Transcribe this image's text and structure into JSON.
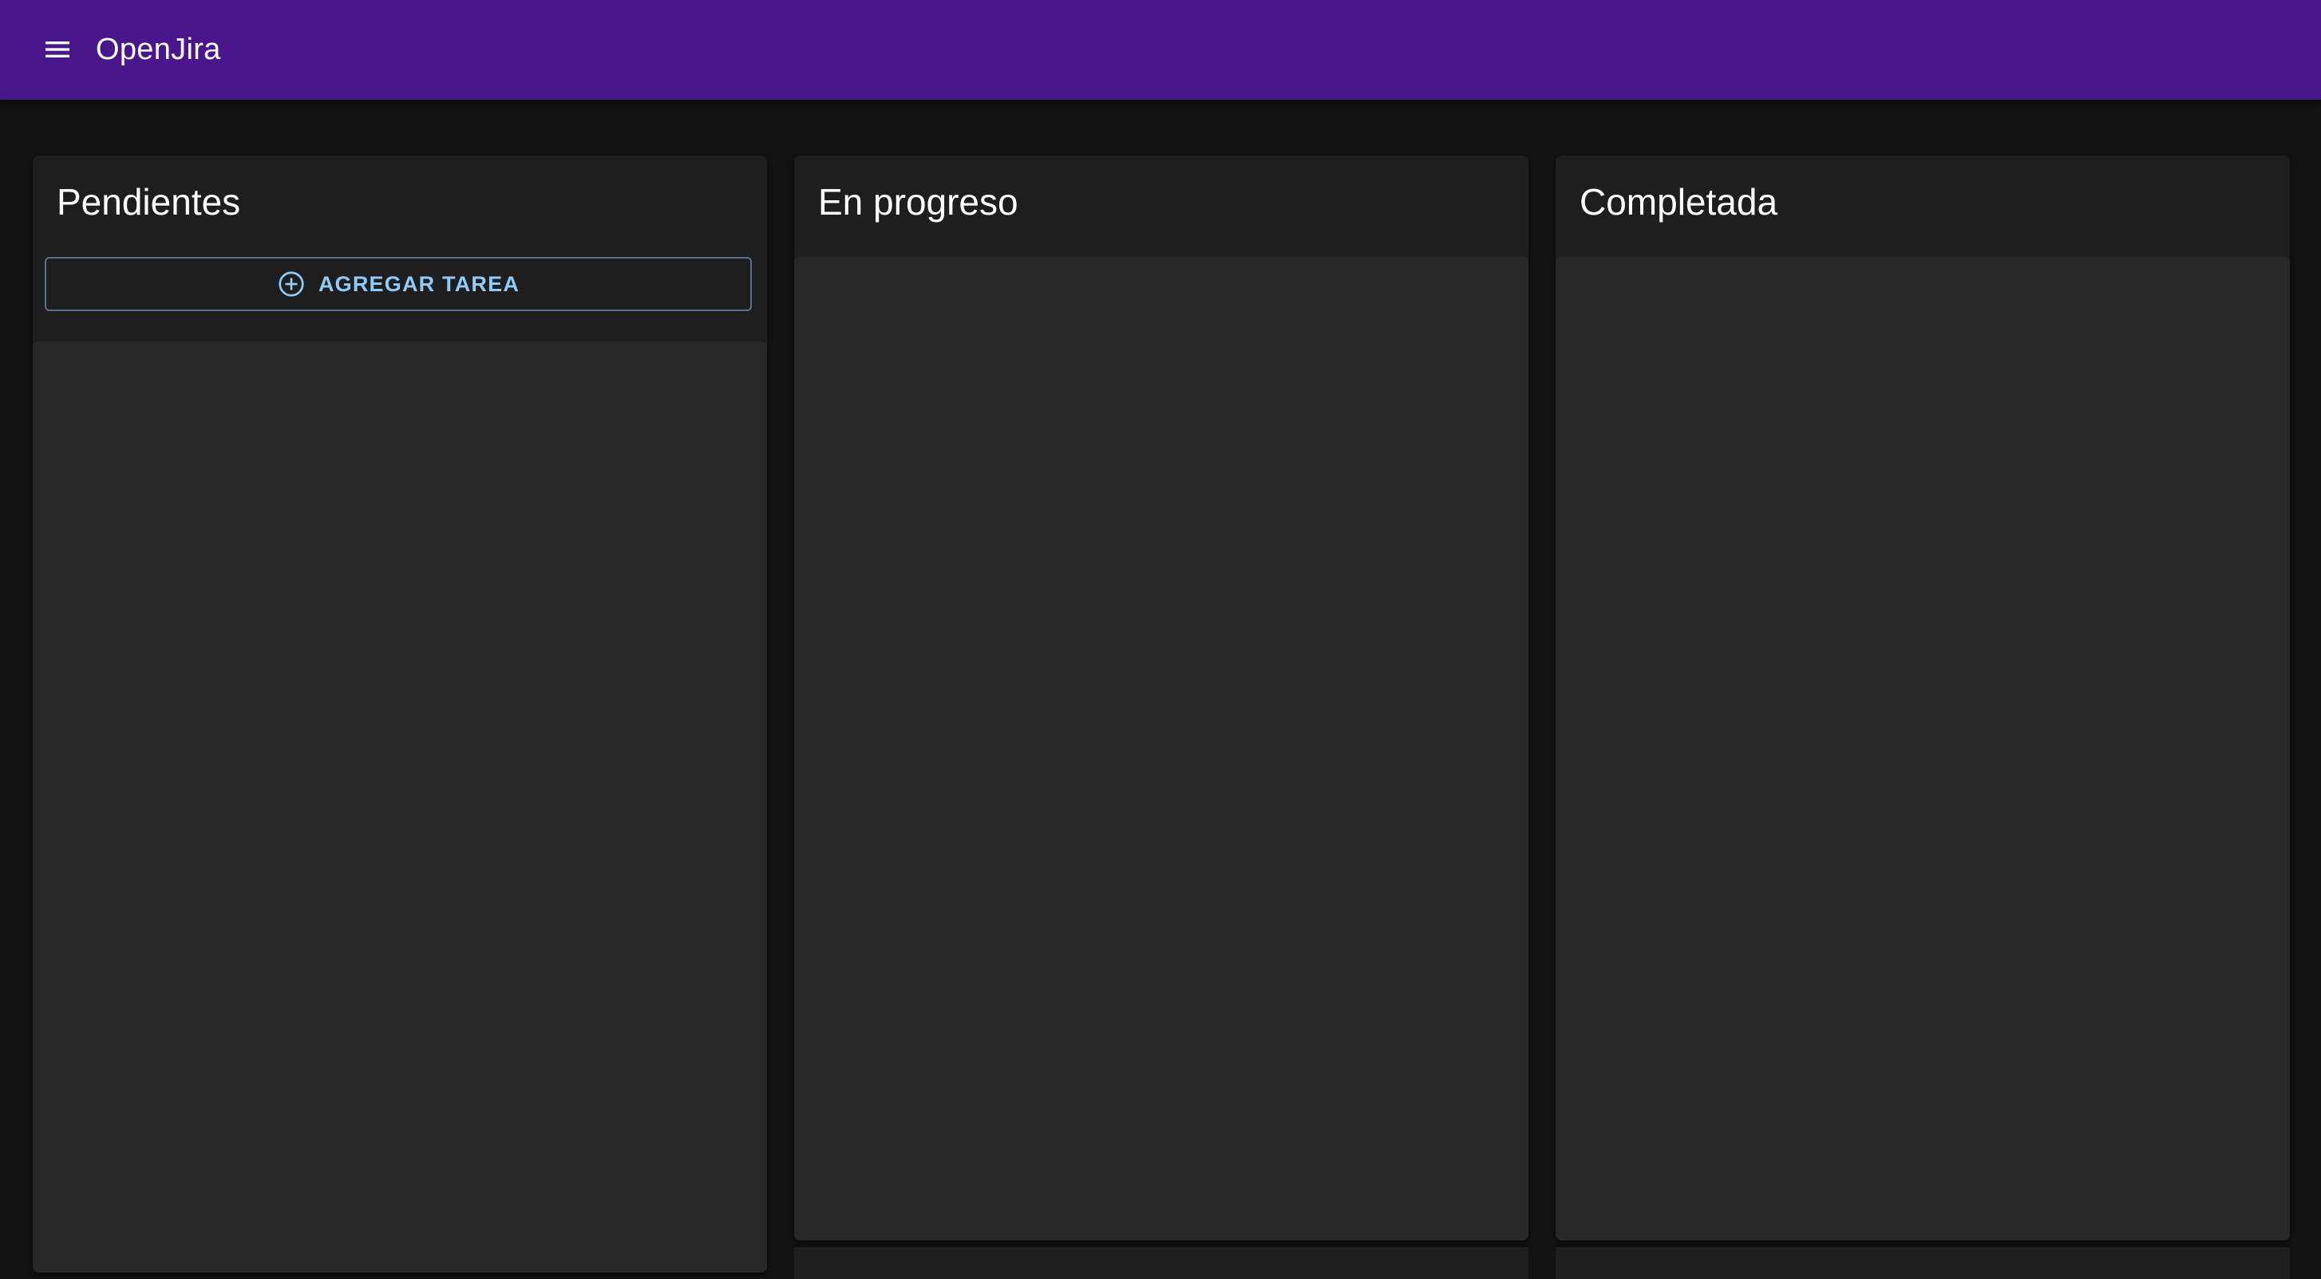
{
  "appbar": {
    "title": "OpenJira",
    "menu_icon": "menu-icon",
    "color": "#4a168b"
  },
  "columns": [
    {
      "title": "Pendientes",
      "add_button": {
        "label": "AGREGAR TAREA",
        "icon": "add-circle-icon"
      },
      "tasks": []
    },
    {
      "title": "En progreso",
      "tasks": []
    },
    {
      "title": "Completada",
      "tasks": []
    }
  ],
  "theme": {
    "background": "#121212",
    "panel": "#1e1e1e",
    "list": "#282828",
    "accent": "#90caf9"
  }
}
